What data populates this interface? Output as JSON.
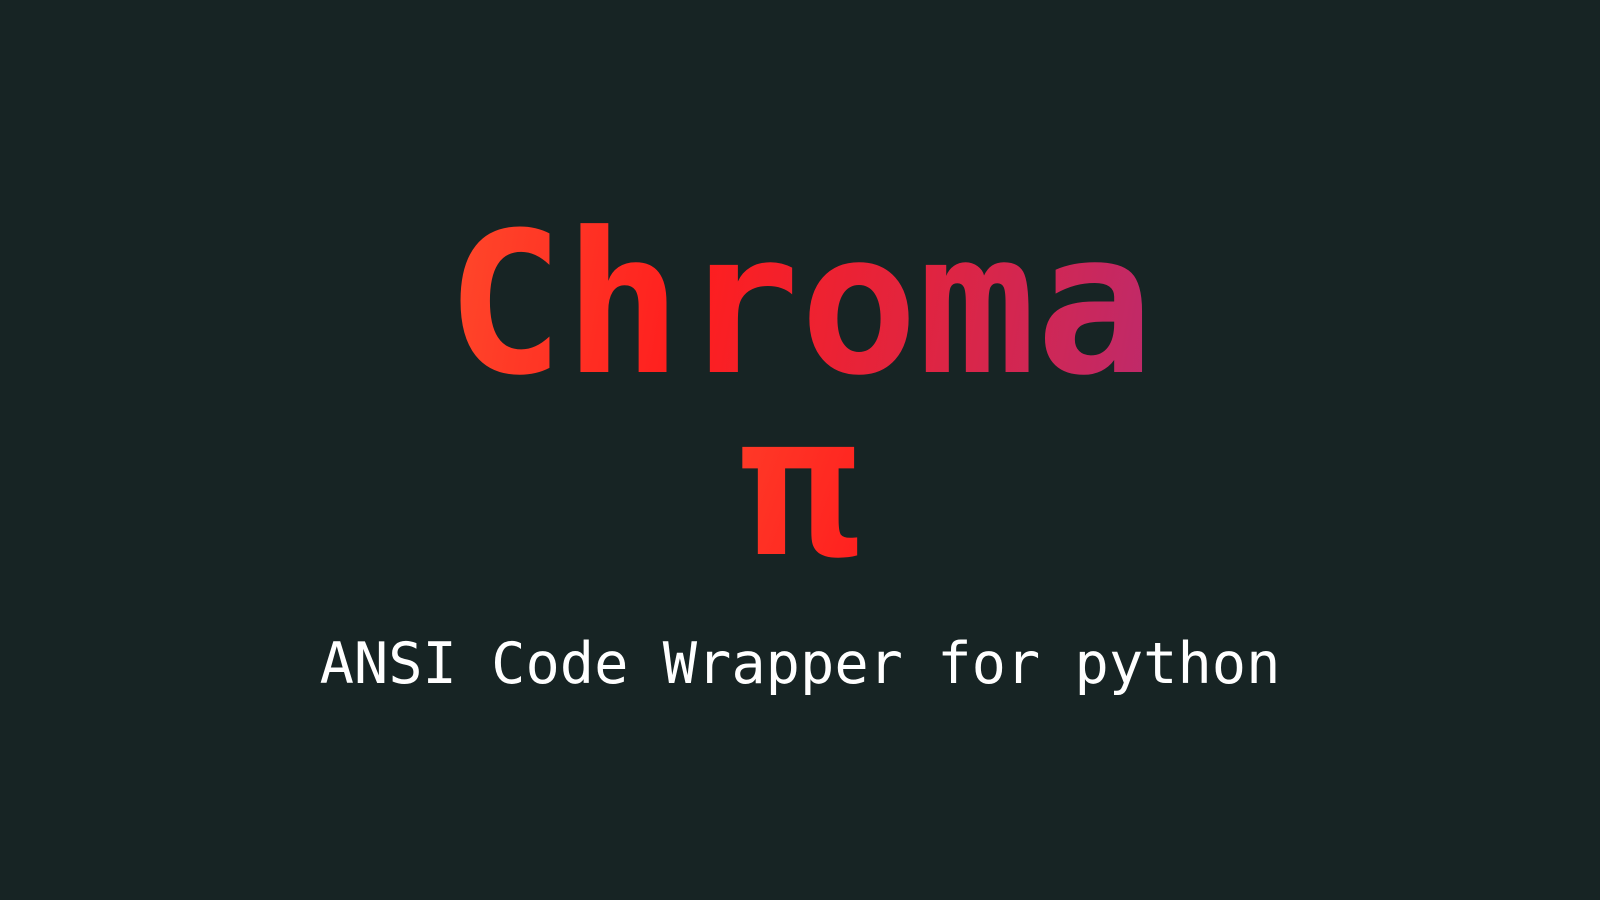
{
  "logo": {
    "title": "Chroma",
    "symbol": "π"
  },
  "subtitle": "ANSI Code Wrapper for python",
  "colors": {
    "background": "#172424",
    "gradient_start": "#ff4a2b",
    "gradient_mid": "#ff1e1e",
    "gradient_end": "#bd2a6c",
    "subtitle": "#ffffff"
  }
}
